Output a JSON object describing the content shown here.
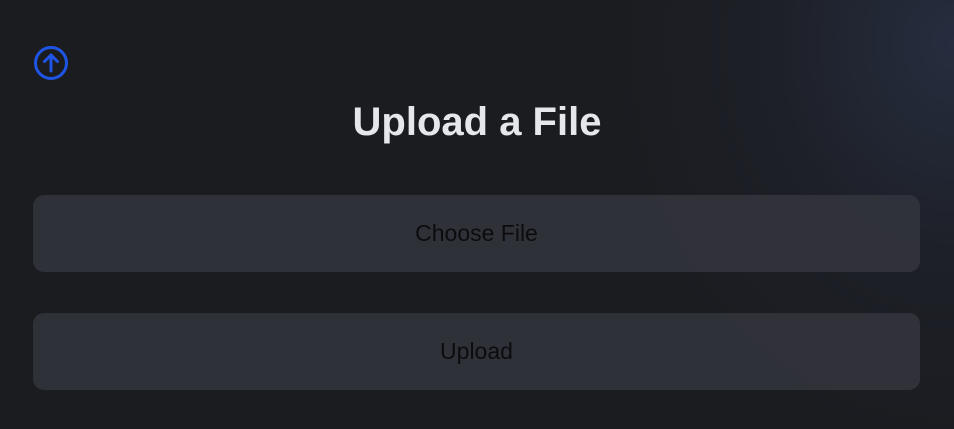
{
  "header": {
    "icon": "upload-circle-icon",
    "icon_color": "#1f55e6",
    "title": "Upload a File"
  },
  "form": {
    "choose_file_label": "Choose File",
    "upload_label": "Upload"
  },
  "colors": {
    "background": "#1b1c20",
    "button_background": "#33353d",
    "title_text": "#e6e7ea",
    "button_text": "#0c0c0e"
  }
}
